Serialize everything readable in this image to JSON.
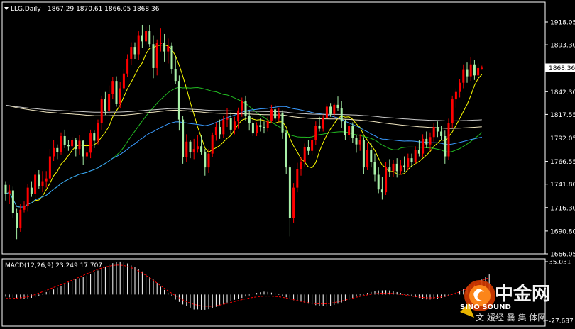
{
  "header": {
    "symbol": "LLG,Daily",
    "ohlc": "1867.29 1870.61 1866.05 1868.36",
    "dropdown_icon": "triangle-down-icon"
  },
  "macd_header": "MACD(12,26,9) 23.249 17.707",
  "watermark": {
    "logo_icon": "sinosound-swirl-logo",
    "cn_title": "中金网",
    "en_title": "SINO SOUND",
    "cn_sub": "文 嫒经 嘦 集 体网"
  },
  "colors": {
    "background": "#000000",
    "frame": "#ffffff",
    "bull_candle": "#ff0000",
    "bear_candle": "#a8f0a8",
    "ma_fast": "#ffff00",
    "ma_mid": "#3a9bff",
    "ma_green": "#22bb22",
    "ma_slow1": "#f0e6c0",
    "ma_slow2": "#c8c8c8",
    "macd_hist": "#ffffff",
    "macd_signal": "#ff0000",
    "price_tag_bg": "#ffffff",
    "price_tag_fg": "#000000"
  },
  "chart_data": {
    "type": "candlestick",
    "price_axis": {
      "min": 1666.05,
      "max": 1918.05,
      "ticks": [
        "1918.05",
        "1893.30",
        "1868.36",
        "1842.30",
        "1817.55",
        "1792.05",
        "1766.55",
        "1741.80",
        "1716.30",
        "1690.80",
        "1666.05"
      ],
      "current": "1868.36"
    },
    "macd_axis": {
      "min": -27.687,
      "max": 35.031,
      "ticks": [
        "35.031",
        "-27.687"
      ]
    },
    "candles": [
      [
        1741.0,
        1745.0,
        1724.0,
        1731.0
      ],
      [
        1731.0,
        1741.0,
        1720.0,
        1735.0
      ],
      [
        1735.0,
        1739.0,
        1705.0,
        1710.0
      ],
      [
        1710.0,
        1715.0,
        1682.0,
        1694.0
      ],
      [
        1694.0,
        1720.0,
        1690.0,
        1714.0
      ],
      [
        1714.0,
        1723.0,
        1711.0,
        1718.0
      ],
      [
        1718.0,
        1742.0,
        1712.0,
        1738.0
      ],
      [
        1738.0,
        1745.0,
        1728.0,
        1731.0
      ],
      [
        1731.0,
        1755.0,
        1726.0,
        1752.0
      ],
      [
        1752.0,
        1757.0,
        1737.0,
        1740.0
      ],
      [
        1740.0,
        1756.0,
        1733.0,
        1745.0
      ],
      [
        1745.0,
        1756.0,
        1738.0,
        1748.0
      ],
      [
        1748.0,
        1780.0,
        1745.0,
        1772.0
      ],
      [
        1772.0,
        1790.0,
        1767.0,
        1781.0
      ],
      [
        1781.0,
        1785.0,
        1769.0,
        1777.0
      ],
      [
        1777.0,
        1798.0,
        1774.0,
        1794.0
      ],
      [
        1794.0,
        1801.0,
        1781.0,
        1784.0
      ],
      [
        1784.0,
        1790.0,
        1778.0,
        1783.0
      ],
      [
        1783.0,
        1793.0,
        1779.0,
        1790.0
      ],
      [
        1790.0,
        1792.0,
        1772.0,
        1780.0
      ],
      [
        1780.0,
        1795.0,
        1774.0,
        1789.0
      ],
      [
        1789.0,
        1790.0,
        1763.0,
        1772.0
      ],
      [
        1772.0,
        1787.0,
        1768.0,
        1776.0
      ],
      [
        1776.0,
        1801.0,
        1770.0,
        1797.0
      ],
      [
        1797.0,
        1800.0,
        1781.0,
        1789.0
      ],
      [
        1789.0,
        1812.0,
        1785.0,
        1808.0
      ],
      [
        1808.0,
        1838.0,
        1801.0,
        1834.0
      ],
      [
        1834.0,
        1842.0,
        1817.0,
        1821.0
      ],
      [
        1821.0,
        1849.0,
        1817.0,
        1840.0
      ],
      [
        1840.0,
        1858.0,
        1834.0,
        1854.0
      ],
      [
        1854.0,
        1859.0,
        1826.0,
        1829.0
      ],
      [
        1829.0,
        1853.0,
        1824.0,
        1846.0
      ],
      [
        1846.0,
        1867.0,
        1844.0,
        1862.0
      ],
      [
        1862.0,
        1883.0,
        1858.0,
        1878.0
      ],
      [
        1878.0,
        1896.0,
        1871.0,
        1891.0
      ],
      [
        1891.0,
        1896.0,
        1878.0,
        1883.0
      ],
      [
        1883.0,
        1908.0,
        1877.0,
        1903.0
      ],
      [
        1903.0,
        1915.0,
        1890.0,
        1897.0
      ],
      [
        1897.0,
        1913.0,
        1893.0,
        1908.0
      ],
      [
        1908.0,
        1915.0,
        1891.0,
        1894.0
      ],
      [
        1894.0,
        1903.0,
        1857.0,
        1868.0
      ],
      [
        1868.0,
        1899.0,
        1860.0,
        1895.0
      ],
      [
        1895.0,
        1911.0,
        1886.0,
        1895.0
      ],
      [
        1895.0,
        1905.0,
        1875.0,
        1886.0
      ],
      [
        1886.0,
        1900.0,
        1873.0,
        1892.0
      ],
      [
        1892.0,
        1896.0,
        1862.0,
        1867.0
      ],
      [
        1867.0,
        1881.0,
        1851.0,
        1854.0
      ],
      [
        1854.0,
        1860.0,
        1800.0,
        1812.0
      ],
      [
        1812.0,
        1816.0,
        1764.0,
        1771.0
      ],
      [
        1771.0,
        1796.0,
        1766.0,
        1788.0
      ],
      [
        1788.0,
        1790.0,
        1770.0,
        1777.0
      ],
      [
        1777.0,
        1791.0,
        1769.0,
        1780.0
      ],
      [
        1780.0,
        1795.0,
        1776.0,
        1783.0
      ],
      [
        1783.0,
        1795.0,
        1774.0,
        1777.0
      ],
      [
        1777.0,
        1780.0,
        1751.0,
        1760.0
      ],
      [
        1760.0,
        1780.0,
        1754.0,
        1775.0
      ],
      [
        1775.0,
        1798.0,
        1771.0,
        1795.0
      ],
      [
        1795.0,
        1809.0,
        1789.0,
        1804.0
      ],
      [
        1804.0,
        1812.0,
        1791.0,
        1796.0
      ],
      [
        1796.0,
        1816.0,
        1792.0,
        1812.0
      ],
      [
        1812.0,
        1824.0,
        1804.0,
        1814.0
      ],
      [
        1814.0,
        1820.0,
        1796.0,
        1801.0
      ],
      [
        1801.0,
        1815.0,
        1796.0,
        1810.0
      ],
      [
        1810.0,
        1825.0,
        1802.0,
        1822.0
      ],
      [
        1822.0,
        1836.0,
        1815.0,
        1832.0
      ],
      [
        1832.0,
        1838.0,
        1811.0,
        1816.0
      ],
      [
        1816.0,
        1822.0,
        1800.0,
        1808.0
      ],
      [
        1808.0,
        1815.0,
        1794.0,
        1797.0
      ],
      [
        1797.0,
        1809.0,
        1794.0,
        1806.0
      ],
      [
        1806.0,
        1814.0,
        1799.0,
        1804.0
      ],
      [
        1804.0,
        1810.0,
        1797.0,
        1803.0
      ],
      [
        1803.0,
        1815.0,
        1799.0,
        1811.0
      ],
      [
        1811.0,
        1828.0,
        1808.0,
        1823.0
      ],
      [
        1823.0,
        1828.0,
        1810.0,
        1813.0
      ],
      [
        1813.0,
        1825.0,
        1810.0,
        1819.0
      ],
      [
        1819.0,
        1822.0,
        1791.0,
        1798.0
      ],
      [
        1798.0,
        1801.0,
        1753.0,
        1760.0
      ],
      [
        1760.0,
        1763.0,
        1685.0,
        1705.0
      ],
      [
        1705.0,
        1743.0,
        1700.0,
        1738.0
      ],
      [
        1738.0,
        1765.0,
        1733.0,
        1758.0
      ],
      [
        1758.0,
        1771.0,
        1751.0,
        1766.0
      ],
      [
        1766.0,
        1786.0,
        1761.0,
        1782.0
      ],
      [
        1782.0,
        1790.0,
        1774.0,
        1778.0
      ],
      [
        1778.0,
        1796.0,
        1774.0,
        1790.0
      ],
      [
        1790.0,
        1810.0,
        1784.0,
        1805.0
      ],
      [
        1805.0,
        1815.0,
        1799.0,
        1802.0
      ],
      [
        1802.0,
        1817.0,
        1799.0,
        1814.0
      ],
      [
        1814.0,
        1829.0,
        1812.0,
        1826.0
      ],
      [
        1826.0,
        1830.0,
        1815.0,
        1818.0
      ],
      [
        1818.0,
        1830.0,
        1813.0,
        1828.0
      ],
      [
        1828.0,
        1837.0,
        1821.0,
        1824.0
      ],
      [
        1824.0,
        1832.0,
        1803.0,
        1810.0
      ],
      [
        1810.0,
        1812.0,
        1790.0,
        1795.0
      ],
      [
        1795.0,
        1808.0,
        1790.0,
        1805.0
      ],
      [
        1805.0,
        1809.0,
        1787.0,
        1792.0
      ],
      [
        1792.0,
        1795.0,
        1776.0,
        1785.0
      ],
      [
        1785.0,
        1796.0,
        1778.0,
        1790.0
      ],
      [
        1790.0,
        1793.0,
        1753.0,
        1760.0
      ],
      [
        1760.0,
        1787.0,
        1757.0,
        1779.0
      ],
      [
        1779.0,
        1786.0,
        1760.0,
        1766.0
      ],
      [
        1766.0,
        1775.0,
        1745.0,
        1752.0
      ],
      [
        1752.0,
        1760.0,
        1732.0,
        1736.0
      ],
      [
        1736.0,
        1750.0,
        1725.0,
        1733.0
      ],
      [
        1733.0,
        1766.0,
        1730.0,
        1760.0
      ],
      [
        1760.0,
        1769.0,
        1750.0,
        1756.0
      ],
      [
        1756.0,
        1768.0,
        1750.0,
        1764.0
      ],
      [
        1764.0,
        1770.0,
        1749.0,
        1756.0
      ],
      [
        1756.0,
        1768.0,
        1752.0,
        1762.0
      ],
      [
        1762.0,
        1772.0,
        1755.0,
        1760.0
      ],
      [
        1760.0,
        1775.0,
        1757.0,
        1770.0
      ],
      [
        1770.0,
        1775.0,
        1760.0,
        1766.0
      ],
      [
        1766.0,
        1783.0,
        1764.0,
        1779.0
      ],
      [
        1779.0,
        1790.0,
        1772.0,
        1775.0
      ],
      [
        1775.0,
        1796.0,
        1771.0,
        1791.0
      ],
      [
        1791.0,
        1799.0,
        1781.0,
        1785.0
      ],
      [
        1785.0,
        1798.0,
        1778.0,
        1793.0
      ],
      [
        1793.0,
        1808.0,
        1788.0,
        1804.0
      ],
      [
        1804.0,
        1810.0,
        1793.0,
        1799.0
      ],
      [
        1799.0,
        1805.0,
        1790.0,
        1794.0
      ],
      [
        1794.0,
        1800.0,
        1764.0,
        1772.0
      ],
      [
        1772.0,
        1813.0,
        1768.0,
        1808.0
      ],
      [
        1808.0,
        1838.0,
        1803.0,
        1834.0
      ],
      [
        1834.0,
        1846.0,
        1825.0,
        1842.0
      ],
      [
        1842.0,
        1856.0,
        1836.0,
        1852.0
      ],
      [
        1852.0,
        1872.0,
        1846.0,
        1866.0
      ],
      [
        1866.0,
        1874.0,
        1852.0,
        1859.0
      ],
      [
        1859.0,
        1880.0,
        1854.0,
        1872.0
      ],
      [
        1872.0,
        1877.0,
        1855.0,
        1860.0
      ],
      [
        1860.0,
        1873.0,
        1852.0,
        1868.0
      ],
      [
        1867.29,
        1870.61,
        1866.05,
        1868.36
      ]
    ],
    "macd_hist": [
      -2.3,
      -3.0,
      -3.5,
      -3.8,
      -4.1,
      -4.4,
      -4.2,
      -3.5,
      -2.5,
      -1.2,
      0.8,
      2.6,
      4.0,
      5.4,
      7.4,
      9.3,
      11.1,
      12.8,
      14.6,
      16.3,
      17.4,
      18.9,
      20.2,
      21.7,
      23.6,
      25.6,
      27.9,
      29.8,
      31.7,
      33.4,
      34.6,
      35.1,
      34.3,
      33.1,
      31.0,
      29.1,
      27.3,
      24.6,
      21.6,
      18.7,
      15.9,
      12.4,
      8.3,
      4.9,
      1.5,
      -1.9,
      -5.4,
      -7.9,
      -10.6,
      -12.2,
      -14.0,
      -16.0,
      -15.9,
      -16.3,
      -16.3,
      -15.7,
      -14.2,
      -13.1,
      -11.5,
      -10.4,
      -8.6,
      -7.2,
      -5.6,
      -4.3,
      -3.6,
      -2.1,
      -0.9,
      0.3,
      1.7,
      2.4,
      3.0,
      2.7,
      2.0,
      1.3,
      -0.5,
      -1.7,
      -2.9,
      -4.7,
      -6.0,
      -7.1,
      -7.8,
      -9.0,
      -9.7,
      -10.5,
      -11.3,
      -12.1,
      -12.2,
      -12.8,
      -11.8,
      -10.9,
      -9.8,
      -8.5,
      -7.0,
      -5.6,
      -3.8,
      -2.2,
      -0.8,
      0.5,
      1.7,
      2.7,
      3.7,
      4.3,
      4.4,
      4.6,
      4.3,
      3.6,
      2.6,
      1.7,
      0.6,
      -0.6,
      -1.6,
      -2.8,
      -3.6,
      -4.6,
      -5.2,
      -5.3,
      -4.9,
      -4.4,
      -3.5,
      -2.6,
      -1.2,
      0.7,
      2.3,
      4.0,
      6.0,
      7.8,
      9.6,
      11.8,
      13.6,
      15.9,
      18.6,
      21.4
    ],
    "macd_signal": [
      -4.0,
      -4.2,
      -4.0,
      -3.8,
      -3.5,
      -3.0,
      -2.4,
      -1.4,
      0.0,
      1.5,
      3.0,
      4.4,
      6.0,
      7.5,
      9.0,
      10.5,
      12.0,
      13.6,
      15.2,
      16.9,
      18.6,
      20.4,
      22.1,
      23.8,
      25.4,
      26.9,
      28.2,
      29.3,
      30.2,
      30.9,
      31.3,
      31.3,
      30.9,
      30.0,
      28.7,
      27.0,
      25.1,
      22.9,
      20.4,
      17.8,
      15.1,
      12.3,
      9.4,
      6.6,
      3.9,
      1.3,
      -1.3,
      -3.6,
      -5.7,
      -7.6,
      -9.2,
      -10.5,
      -11.4,
      -12.1,
      -12.5,
      -12.6,
      -12.4,
      -11.9,
      -11.2,
      -10.4,
      -9.5,
      -8.5,
      -7.5,
      -6.5,
      -5.5,
      -4.6,
      -3.8,
      -3.1,
      -2.5,
      -2.1,
      -1.8,
      -1.7,
      -1.8,
      -2.0,
      -2.4,
      -3.0,
      -3.7,
      -4.6,
      -5.5,
      -6.4,
      -7.3,
      -8.1,
      -8.8,
      -9.4,
      -9.8,
      -10.0,
      -10.0,
      -9.8,
      -9.3,
      -8.6,
      -7.8,
      -6.9,
      -5.9,
      -4.9,
      -3.9,
      -2.9,
      -2.0,
      -1.1,
      -0.4,
      0.3,
      0.8,
      1.2,
      1.4,
      1.5,
      1.4,
      1.1,
      0.7,
      0.2,
      -0.4,
      -1.0,
      -1.6,
      -2.2,
      -2.7,
      -3.1,
      -3.4,
      -3.5,
      -3.4,
      -3.1,
      -2.6,
      -1.9,
      -1.0,
      0.1,
      1.4,
      2.9,
      4.6,
      6.4,
      8.3,
      10.3,
      12.4,
      14.6,
      16.7,
      17.7
    ],
    "moving_averages": [
      {
        "color_key": "ma_fast",
        "period": 8
      },
      {
        "color_key": "ma_green",
        "period": 30
      },
      {
        "color_key": "ma_mid",
        "period": 55
      },
      {
        "color_key": "ma_slow1",
        "period": 150
      },
      {
        "color_key": "ma_slow2",
        "period": 220
      }
    ],
    "grid": false
  }
}
